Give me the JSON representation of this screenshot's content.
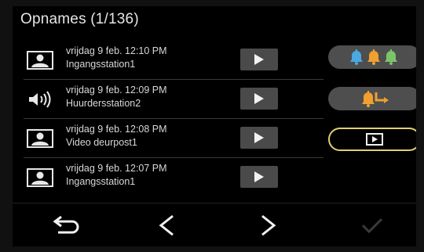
{
  "header": {
    "title": "Opnames (1/136)"
  },
  "recordings": [
    {
      "type": "video",
      "icon": "person-video-icon",
      "date": "vrijdag 9 feb. 12:10 PM",
      "station": "Ingangsstation1"
    },
    {
      "type": "audio",
      "icon": "speaker-icon",
      "date": "vrijdag 9 feb. 12:09 PM",
      "station": "Huurdersstation2"
    },
    {
      "type": "video",
      "icon": "person-video-icon",
      "date": "vrijdag 9 feb. 12:08 PM",
      "station": "Video deurpost1"
    },
    {
      "type": "video",
      "icon": "person-video-icon",
      "date": "vrijdag 9 feb. 12:07 PM",
      "station": "Ingangsstation1"
    }
  ],
  "side_buttons": [
    {
      "icon": "three-bells-icon",
      "selected": false
    },
    {
      "icon": "bell-transfer-icon",
      "selected": false
    },
    {
      "icon": "play-icon",
      "selected": true
    }
  ],
  "footer": {
    "back_icon": "return-arrow-icon",
    "prev_icon": "chevron-left-icon",
    "next_icon": "chevron-right-icon",
    "confirm_icon": "checkmark-icon"
  },
  "colors": {
    "bell_blue": "#4aa9e0",
    "bell_orange": "#f0a030",
    "bell_green": "#7cc46a",
    "selected_border": "#e2cf72",
    "button_gray": "#4e4e4e"
  }
}
